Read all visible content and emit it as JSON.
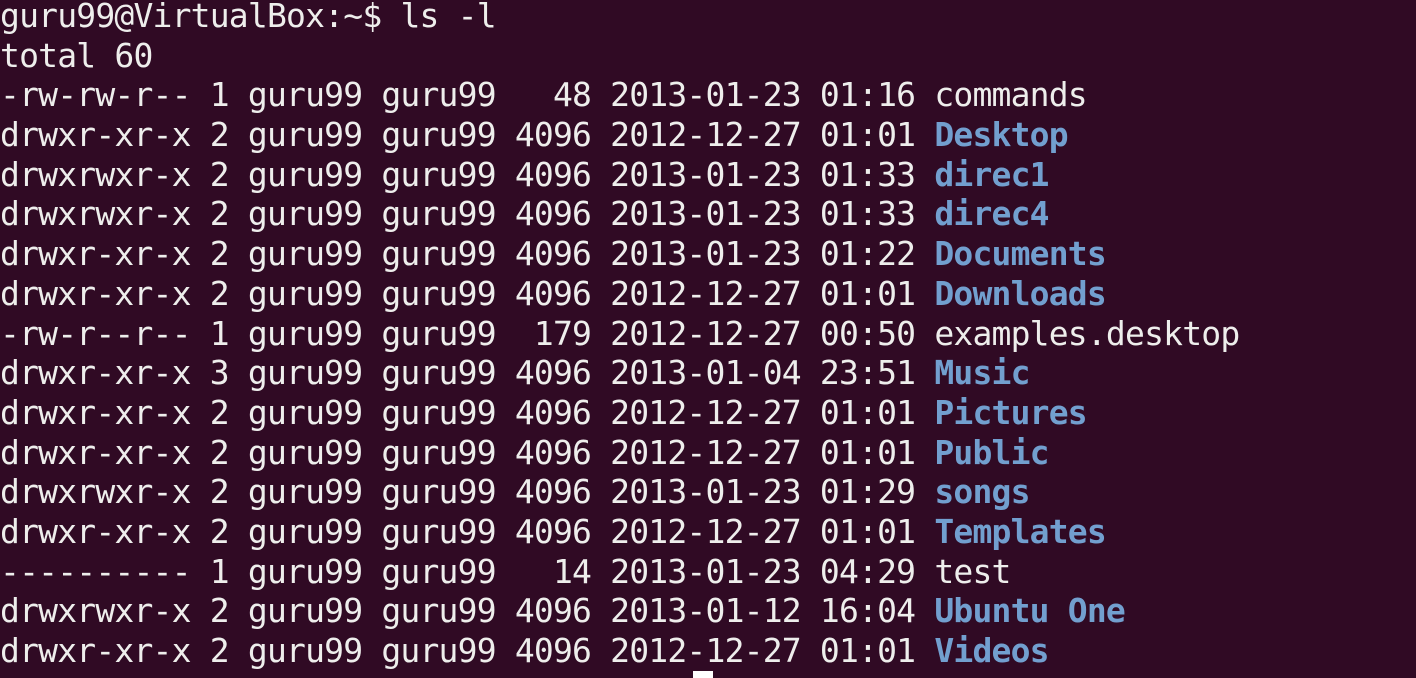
{
  "prompt": {
    "user_host": "guru99@VirtualBox",
    "path": "~",
    "symbol": "$",
    "command": "ls -l"
  },
  "total_line": "total 60",
  "listing": [
    {
      "perms": "-rw-rw-r--",
      "links": "1",
      "owner": "guru99",
      "group": "guru99",
      "size": "  48",
      "date": "2013-01-23",
      "time": "01:16",
      "name": "commands",
      "kind": "file"
    },
    {
      "perms": "drwxr-xr-x",
      "links": "2",
      "owner": "guru99",
      "group": "guru99",
      "size": "4096",
      "date": "2012-12-27",
      "time": "01:01",
      "name": "Desktop",
      "kind": "dir"
    },
    {
      "perms": "drwxrwxr-x",
      "links": "2",
      "owner": "guru99",
      "group": "guru99",
      "size": "4096",
      "date": "2013-01-23",
      "time": "01:33",
      "name": "direc1",
      "kind": "dir"
    },
    {
      "perms": "drwxrwxr-x",
      "links": "2",
      "owner": "guru99",
      "group": "guru99",
      "size": "4096",
      "date": "2013-01-23",
      "time": "01:33",
      "name": "direc4",
      "kind": "dir"
    },
    {
      "perms": "drwxr-xr-x",
      "links": "2",
      "owner": "guru99",
      "group": "guru99",
      "size": "4096",
      "date": "2013-01-23",
      "time": "01:22",
      "name": "Documents",
      "kind": "dir"
    },
    {
      "perms": "drwxr-xr-x",
      "links": "2",
      "owner": "guru99",
      "group": "guru99",
      "size": "4096",
      "date": "2012-12-27",
      "time": "01:01",
      "name": "Downloads",
      "kind": "dir"
    },
    {
      "perms": "-rw-r--r--",
      "links": "1",
      "owner": "guru99",
      "group": "guru99",
      "size": " 179",
      "date": "2012-12-27",
      "time": "00:50",
      "name": "examples.desktop",
      "kind": "file"
    },
    {
      "perms": "drwxr-xr-x",
      "links": "3",
      "owner": "guru99",
      "group": "guru99",
      "size": "4096",
      "date": "2013-01-04",
      "time": "23:51",
      "name": "Music",
      "kind": "dir"
    },
    {
      "perms": "drwxr-xr-x",
      "links": "2",
      "owner": "guru99",
      "group": "guru99",
      "size": "4096",
      "date": "2012-12-27",
      "time": "01:01",
      "name": "Pictures",
      "kind": "dir"
    },
    {
      "perms": "drwxr-xr-x",
      "links": "2",
      "owner": "guru99",
      "group": "guru99",
      "size": "4096",
      "date": "2012-12-27",
      "time": "01:01",
      "name": "Public",
      "kind": "dir"
    },
    {
      "perms": "drwxrwxr-x",
      "links": "2",
      "owner": "guru99",
      "group": "guru99",
      "size": "4096",
      "date": "2013-01-23",
      "time": "01:29",
      "name": "songs",
      "kind": "dir"
    },
    {
      "perms": "drwxr-xr-x",
      "links": "2",
      "owner": "guru99",
      "group": "guru99",
      "size": "4096",
      "date": "2012-12-27",
      "time": "01:01",
      "name": "Templates",
      "kind": "dir"
    },
    {
      "perms": "----------",
      "links": "1",
      "owner": "guru99",
      "group": "guru99",
      "size": "  14",
      "date": "2013-01-23",
      "time": "04:29",
      "name": "test",
      "kind": "file"
    },
    {
      "perms": "drwxrwxr-x",
      "links": "2",
      "owner": "guru99",
      "group": "guru99",
      "size": "4096",
      "date": "2013-01-12",
      "time": "16:04",
      "name": "Ubuntu One",
      "kind": "dir"
    },
    {
      "perms": "drwxr-xr-x",
      "links": "2",
      "owner": "guru99",
      "group": "guru99",
      "size": "4096",
      "date": "2012-12-27",
      "time": "01:01",
      "name": "Videos",
      "kind": "dir"
    }
  ],
  "colors": {
    "background": "#300a24",
    "text": "#eeeeec",
    "directory": "#729fcf",
    "cursor": "#ffffff"
  }
}
